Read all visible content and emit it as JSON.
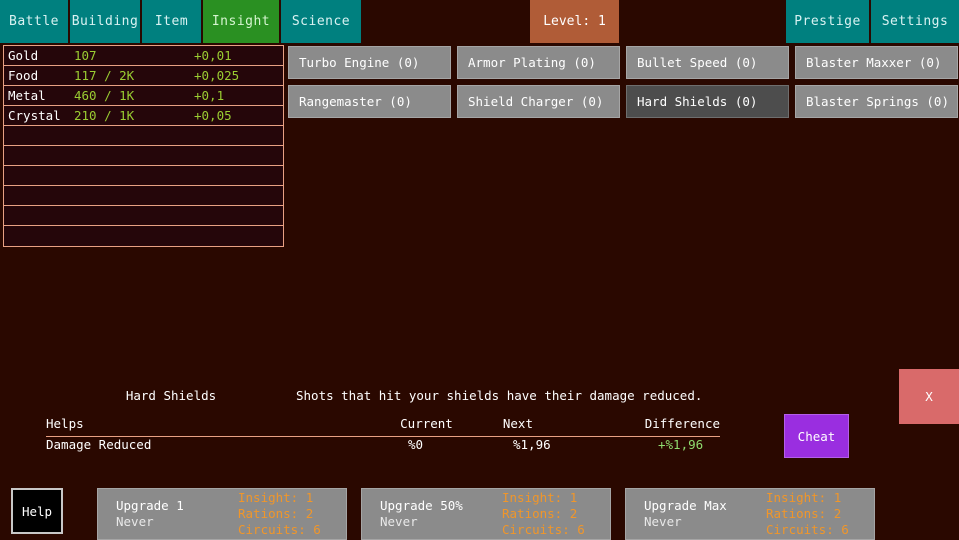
{
  "nav": {
    "tabs": [
      {
        "label": "Battle",
        "name": "tab-battle",
        "active": false
      },
      {
        "label": "Building",
        "name": "tab-building",
        "active": false
      },
      {
        "label": "Item",
        "name": "tab-item",
        "active": false
      },
      {
        "label": "Insight",
        "name": "tab-insight",
        "active": true
      },
      {
        "label": "Science",
        "name": "tab-science",
        "active": false
      }
    ],
    "level_badge": "Level: 1",
    "prestige": "Prestige",
    "settings": "Settings"
  },
  "resources": {
    "rows": [
      {
        "name": "Gold",
        "amount": "107",
        "rate": "+0,01"
      },
      {
        "name": "Food",
        "amount": "117 / 2K",
        "rate": "+0,025"
      },
      {
        "name": "Metal",
        "amount": "460 / 1K",
        "rate": "+0,1"
      },
      {
        "name": "Crystal",
        "amount": "210 / 1K",
        "rate": "+0,05"
      },
      {
        "name": "",
        "amount": "",
        "rate": ""
      },
      {
        "name": "",
        "amount": "",
        "rate": ""
      },
      {
        "name": "",
        "amount": "",
        "rate": ""
      },
      {
        "name": "",
        "amount": "",
        "rate": ""
      },
      {
        "name": "",
        "amount": "",
        "rate": ""
      },
      {
        "name": "",
        "amount": "",
        "rate": ""
      }
    ]
  },
  "science": {
    "upgrades": [
      {
        "label": "Turbo Engine (0)",
        "selected": false
      },
      {
        "label": "Armor Plating (0)",
        "selected": false
      },
      {
        "label": "Bullet Speed (0)",
        "selected": false
      },
      {
        "label": "Blaster Maxxer (0)",
        "selected": false
      },
      {
        "label": "Rangemaster (0)",
        "selected": false
      },
      {
        "label": "Shield Charger (0)",
        "selected": false
      },
      {
        "label": "Hard Shields (0)",
        "selected": true
      },
      {
        "label": "Blaster Springs (0)",
        "selected": false
      }
    ]
  },
  "detail": {
    "title": "Hard Shields",
    "description": "Shots that hit your shields have their damage reduced.",
    "columns": {
      "helps": "Helps",
      "current": "Current",
      "next": "Next",
      "difference": "Difference"
    },
    "stats": [
      {
        "helps": "Damage Reduced",
        "current": "%0",
        "next": "%1,96",
        "difference": "+%1,96"
      }
    ]
  },
  "actions": {
    "cheat": "Cheat",
    "close": "X",
    "help": "Help"
  },
  "purchase": {
    "buttons": [
      {
        "action": "Upgrade 1",
        "timing": "Never",
        "costs": [
          "Insight: 1",
          "Rations: 2",
          "Circuits: 6"
        ]
      },
      {
        "action": "Upgrade 50%",
        "timing": "Never",
        "costs": [
          "Insight: 1",
          "Rations: 2",
          "Circuits: 6"
        ]
      },
      {
        "action": "Upgrade Max",
        "timing": "Never",
        "costs": [
          "Insight: 1",
          "Rations: 2",
          "Circuits: 6"
        ]
      }
    ]
  },
  "colors": {
    "background": "#2a0800",
    "tab": "#00807f",
    "tab_active": "#2a9022",
    "level_badge": "#b05c37",
    "panel_border": "#e8a083",
    "resource_value": "#9acd32",
    "button_gray": "#8b8b8b",
    "button_gray_selected": "#4d4d4d",
    "cost_text": "#f0962a",
    "cheat": "#9a2ee0",
    "close": "#d96a6a",
    "difference_positive": "#8fdc6f"
  }
}
